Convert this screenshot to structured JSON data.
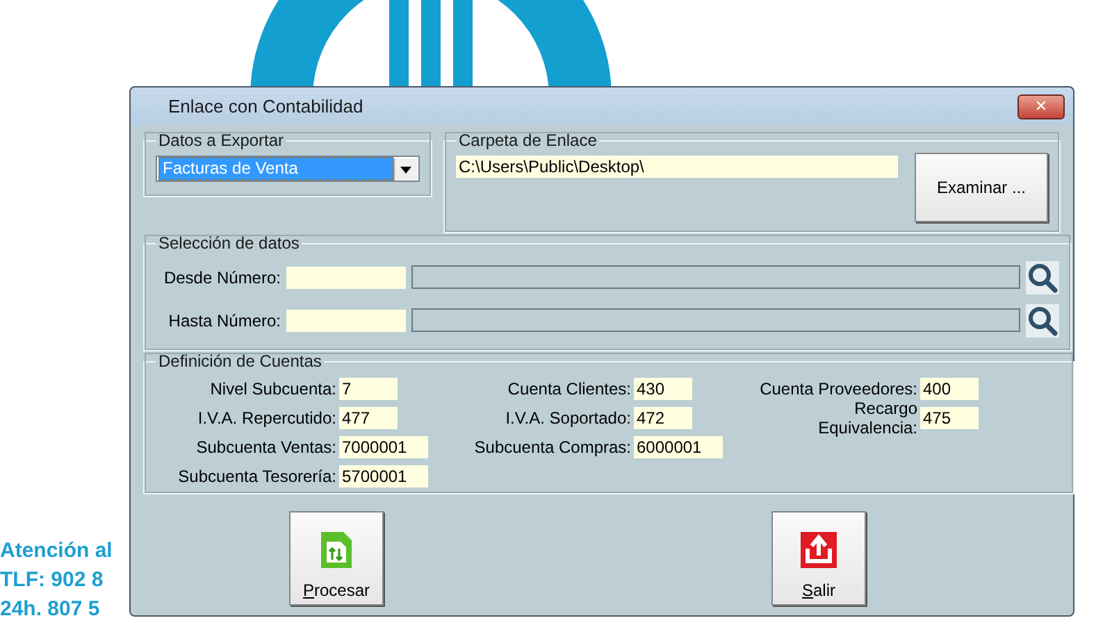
{
  "background": {
    "lines": [
      "Atención al",
      "TLF: 902 8",
      "24h. 807 5"
    ]
  },
  "window": {
    "title": "Enlace con Contabilidad",
    "close": "✕"
  },
  "export": {
    "legend": "Datos a Exportar",
    "value": "Facturas de Venta",
    "selected": true
  },
  "folder": {
    "legend": "Carpeta de Enlace",
    "value": "C:\\Users\\Public\\Desktop\\",
    "button": "Examinar ..."
  },
  "selection": {
    "legend": "Selección de datos",
    "rows": [
      {
        "label": "Desde Número:"
      },
      {
        "label": "Hasta Número:"
      }
    ]
  },
  "accounts": {
    "legend": "Definición de Cuentas",
    "columns": [
      [
        {
          "label": "Nivel Subcuenta:",
          "value": "7"
        },
        {
          "label": "I.V.A. Repercutido:",
          "value": "477"
        },
        {
          "label": "Subcuenta Ventas:",
          "value": "7000001"
        },
        {
          "label": "Subcuenta Tesorería:",
          "value": "5700001"
        }
      ],
      [
        {
          "label": "Cuenta Clientes:",
          "value": "430"
        },
        {
          "label": "I.V.A. Soportado:",
          "value": "472"
        },
        {
          "label": "Subcuenta Compras:",
          "value": "6000001"
        }
      ],
      [
        {
          "label": "Cuenta Proveedores:",
          "value": "400"
        },
        {
          "label": "Recargo Equivalencia:",
          "value": "475"
        }
      ]
    ]
  },
  "buttons": [
    {
      "kind": "process",
      "label": "Procesar"
    },
    {
      "kind": "exit",
      "label": "Salir"
    }
  ]
}
